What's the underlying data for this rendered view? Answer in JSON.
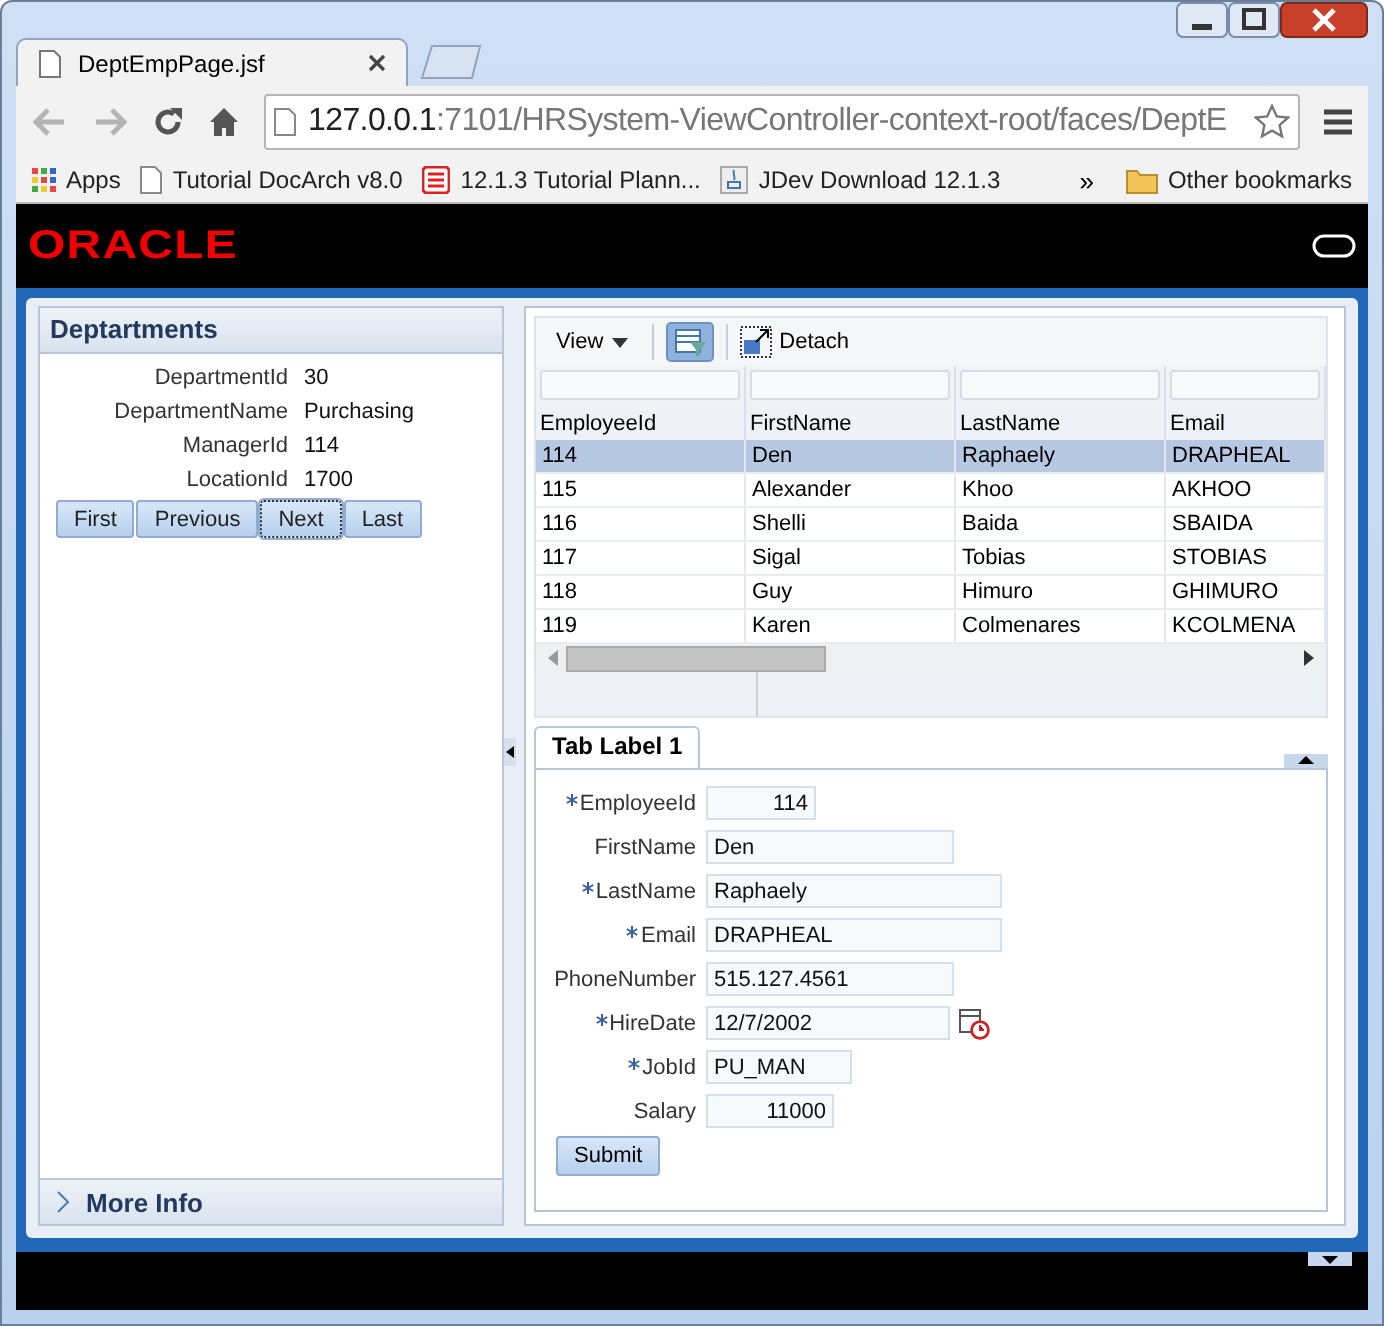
{
  "browser": {
    "tab_title": "DeptEmpPage.jsf",
    "url_host": "127.0.0.1",
    "url_rest": ":7101/HRSystem-ViewController-context-root/faces/DeptE",
    "bookmarks": [
      {
        "kind": "apps",
        "label": "Apps"
      },
      {
        "kind": "page",
        "label": "Tutorial DocArch v8.0"
      },
      {
        "kind": "planner",
        "label": "12.1.3 Tutorial Plann..."
      },
      {
        "kind": "java",
        "label": "JDev Download 12.1.3"
      }
    ],
    "overflow": "»",
    "other": "Other bookmarks"
  },
  "header": {
    "logo": "ORACLE"
  },
  "departments": {
    "title": "Deptartments",
    "fields": [
      {
        "label": "DepartmentId",
        "value": "30"
      },
      {
        "label": "DepartmentName",
        "value": "Purchasing"
      },
      {
        "label": "ManagerId",
        "value": "114"
      },
      {
        "label": "LocationId",
        "value": "1700"
      }
    ],
    "buttons": [
      {
        "label": "First",
        "focused": false
      },
      {
        "label": "Previous",
        "focused": false
      },
      {
        "label": "Next",
        "focused": true
      },
      {
        "label": "Last",
        "focused": false
      }
    ],
    "more_info": "More Info"
  },
  "table": {
    "view_menu": "View",
    "detach": "Detach",
    "columns": [
      "EmployeeId",
      "FirstName",
      "LastName",
      "Email"
    ],
    "rows": [
      {
        "cells": [
          "114",
          "Den",
          "Raphaely",
          "DRAPHEAL"
        ],
        "selected": true
      },
      {
        "cells": [
          "115",
          "Alexander",
          "Khoo",
          "AKHOO"
        ],
        "selected": false
      },
      {
        "cells": [
          "116",
          "Shelli",
          "Baida",
          "SBAIDA"
        ],
        "selected": false
      },
      {
        "cells": [
          "117",
          "Sigal",
          "Tobias",
          "STOBIAS"
        ],
        "selected": false
      },
      {
        "cells": [
          "118",
          "Guy",
          "Himuro",
          "GHIMURO"
        ],
        "selected": false
      },
      {
        "cells": [
          "119",
          "Karen",
          "Colmenares",
          "KCOLMENA"
        ],
        "selected": false
      }
    ]
  },
  "detail": {
    "tab": "Tab Label 1",
    "fields": [
      {
        "label": "EmployeeId",
        "value": "114",
        "required": true,
        "kind": "number"
      },
      {
        "label": "FirstName",
        "value": "Den",
        "required": false,
        "kind": "text"
      },
      {
        "label": "LastName",
        "value": "Raphaely",
        "required": true,
        "kind": "text"
      },
      {
        "label": "Email",
        "value": "DRAPHEAL",
        "required": true,
        "kind": "text"
      },
      {
        "label": "PhoneNumber",
        "value": "515.127.4561",
        "required": false,
        "kind": "text"
      },
      {
        "label": "HireDate",
        "value": "12/7/2002",
        "required": true,
        "kind": "date"
      },
      {
        "label": "JobId",
        "value": "PU_MAN",
        "required": true,
        "kind": "text"
      },
      {
        "label": "Salary",
        "value": "11000",
        "required": false,
        "kind": "number"
      }
    ],
    "submit": "Submit"
  }
}
